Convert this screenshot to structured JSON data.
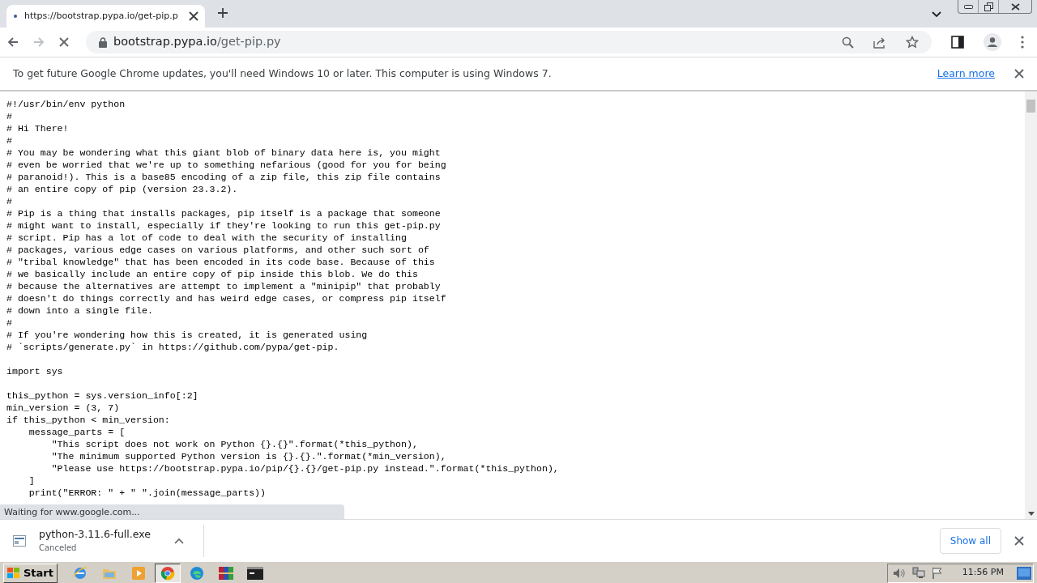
{
  "browser": {
    "tabs": [
      {
        "title": "https://bootstrap.pypa.io/get-pip.p",
        "selected": true
      }
    ],
    "address": {
      "host": "bootstrap.pypa.io",
      "path": "/get-pip.py"
    },
    "loading": true
  },
  "infobar": {
    "message": "To get future Google Chrome updates, you'll need Windows 10 or later. This computer is using Windows 7.",
    "link": "Learn more"
  },
  "code_blocks": [
    [
      "#!/usr/bin/env python",
      "#",
      "# Hi There!",
      "#",
      "# You may be wondering what this giant blob of binary data here is, you might",
      "# even be worried that we're up to something nefarious (good for you for being",
      "# paranoid!). This is a base85 encoding of a zip file, this zip file contains",
      "# an entire copy of pip (version 23.3.2).",
      "#",
      "# Pip is a thing that installs packages, pip itself is a package that someone",
      "# might want to install, especially if they're looking to run this get-pip.py",
      "# script. Pip has a lot of code to deal with the security of installing",
      "# packages, various edge cases on various platforms, and other such sort of",
      "# \"tribal knowledge\" that has been encoded in its code base. Because of this",
      "# we basically include an entire copy of pip inside this blob. We do this",
      "# because the alternatives are attempt to implement a \"minipip\" that probably",
      "# doesn't do things correctly and has weird edge cases, or compress pip itself",
      "# down into a single file.",
      "#",
      "# If you're wondering how this is created, it is generated using",
      "# `scripts/generate.py` in https://github.com/pypa/get-pip."
    ],
    [
      "import sys"
    ],
    [
      "this_python = sys.version_info[:2]",
      "min_version = (3, 7)",
      "if this_python < min_version:",
      "    message_parts = [",
      "        \"This script does not work on Python {}.{}\".format(*this_python),",
      "        \"The minimum supported Python version is {}.{}.\".format(*min_version),",
      "        \"Please use https://bootstrap.pypa.io/pip/{}.{}/get-pip.py instead.\".format(*this_python),",
      "    ]",
      "    print(\"ERROR: \" + \" \".join(message_parts))"
    ]
  ],
  "status_text": "Waiting for www.google.com...",
  "downloads": [
    {
      "filename": "python-3.11.6-full.exe",
      "status": "Canceled"
    }
  ],
  "show_all": "Show all",
  "taskbar": {
    "start": "Start",
    "apps": [
      {
        "kind": "ie",
        "selected": false
      },
      {
        "kind": "folder",
        "selected": false
      },
      {
        "kind": "media",
        "selected": false
      },
      {
        "kind": "chrome",
        "selected": true
      },
      {
        "kind": "edge",
        "selected": false
      },
      {
        "kind": "archive",
        "selected": false
      },
      {
        "kind": "cmd",
        "selected": false
      }
    ],
    "clock": "11:56 PM"
  }
}
